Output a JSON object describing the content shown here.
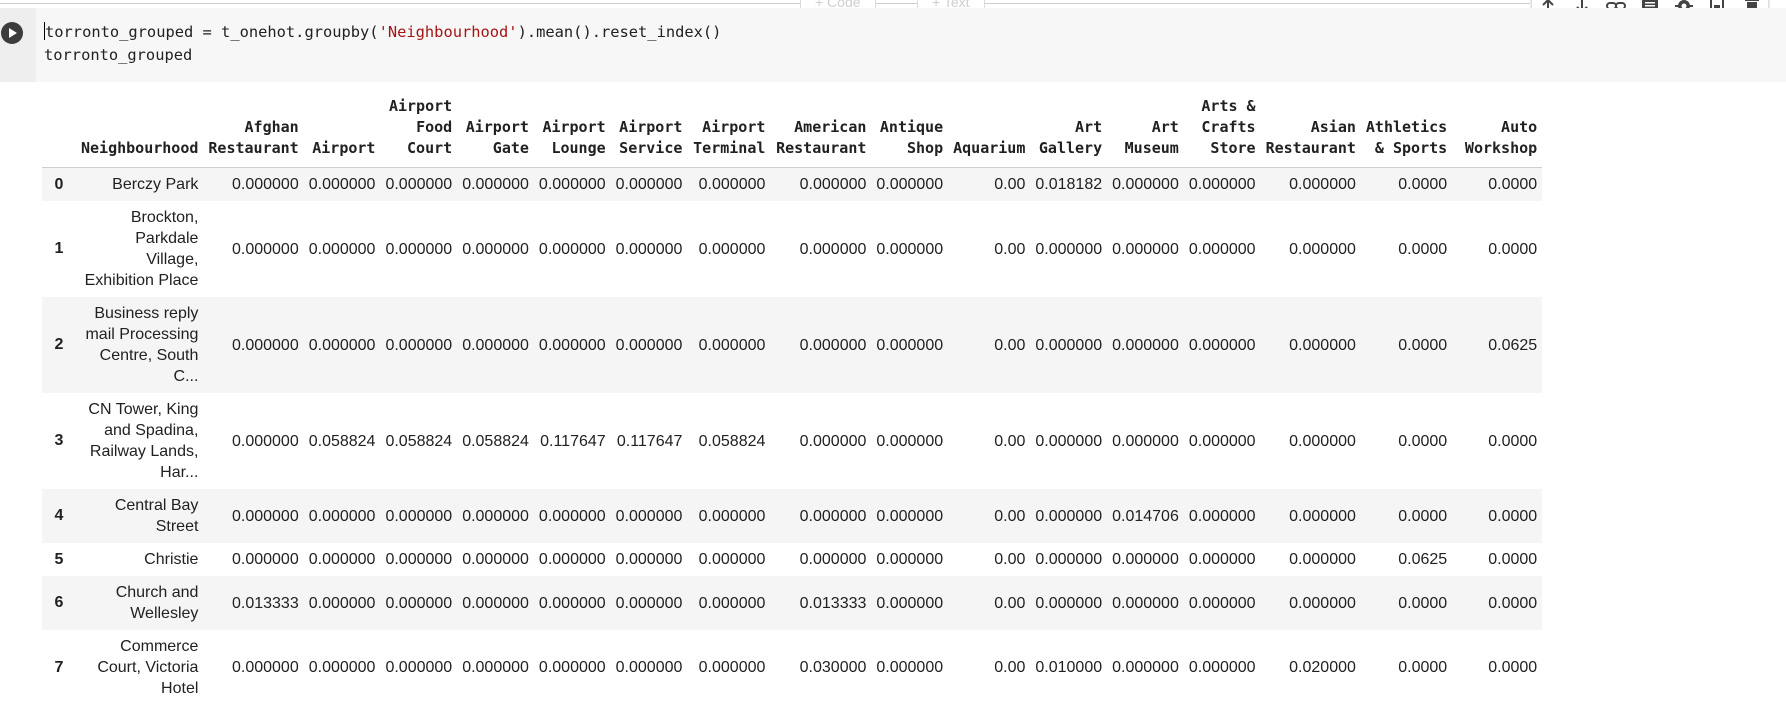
{
  "toolbar": {
    "add_code_label": "+ Code",
    "add_text_label": "+ Text",
    "icons": [
      "arrow-up-icon",
      "arrow-down-icon",
      "link-icon",
      "comment-icon",
      "gear-icon",
      "mirror-cell-icon",
      "delete-icon"
    ]
  },
  "cell": {
    "code_line1_a": "torronto_grouped = t_onehot.groupby(",
    "code_line1_str": "'Neighbourhood'",
    "code_line1_b": ").mean().reset_index()",
    "code_line2": "torronto_grouped"
  },
  "table": {
    "columns": [
      "Neighbourhood",
      "Afghan Restaurant",
      "Airport",
      "Airport Food Court",
      "Airport Gate",
      "Airport Lounge",
      "Airport Service",
      "Airport Terminal",
      "American Restaurant",
      "Antique Shop",
      "Aquarium",
      "Art Gallery",
      "Art Museum",
      "Arts & Crafts Store",
      "Asian Restaurant",
      "Athletics & Sports",
      "Auto Workshop"
    ],
    "rows": [
      {
        "index": "0",
        "cells": [
          "Berczy Park",
          "0.000000",
          "0.000000",
          "0.000000",
          "0.000000",
          "0.000000",
          "0.000000",
          "0.000000",
          "0.000000",
          "0.000000",
          "0.00",
          "0.018182",
          "0.000000",
          "0.000000",
          "0.000000",
          "0.0000",
          "0.0000"
        ]
      },
      {
        "index": "1",
        "cells": [
          "Brockton, Parkdale Village, Exhibition Place",
          "0.000000",
          "0.000000",
          "0.000000",
          "0.000000",
          "0.000000",
          "0.000000",
          "0.000000",
          "0.000000",
          "0.000000",
          "0.00",
          "0.000000",
          "0.000000",
          "0.000000",
          "0.000000",
          "0.0000",
          "0.0000"
        ]
      },
      {
        "index": "2",
        "cells": [
          "Business reply mail Processing Centre, South C...",
          "0.000000",
          "0.000000",
          "0.000000",
          "0.000000",
          "0.000000",
          "0.000000",
          "0.000000",
          "0.000000",
          "0.000000",
          "0.00",
          "0.000000",
          "0.000000",
          "0.000000",
          "0.000000",
          "0.0000",
          "0.0625"
        ]
      },
      {
        "index": "3",
        "cells": [
          "CN Tower, King and Spadina, Railway Lands, Har...",
          "0.000000",
          "0.058824",
          "0.058824",
          "0.058824",
          "0.117647",
          "0.117647",
          "0.058824",
          "0.000000",
          "0.000000",
          "0.00",
          "0.000000",
          "0.000000",
          "0.000000",
          "0.000000",
          "0.0000",
          "0.0000"
        ]
      },
      {
        "index": "4",
        "cells": [
          "Central Bay Street",
          "0.000000",
          "0.000000",
          "0.000000",
          "0.000000",
          "0.000000",
          "0.000000",
          "0.000000",
          "0.000000",
          "0.000000",
          "0.00",
          "0.000000",
          "0.014706",
          "0.000000",
          "0.000000",
          "0.0000",
          "0.0000"
        ]
      },
      {
        "index": "5",
        "cells": [
          "Christie",
          "0.000000",
          "0.000000",
          "0.000000",
          "0.000000",
          "0.000000",
          "0.000000",
          "0.000000",
          "0.000000",
          "0.000000",
          "0.00",
          "0.000000",
          "0.000000",
          "0.000000",
          "0.000000",
          "0.0625",
          "0.0000"
        ]
      },
      {
        "index": "6",
        "cells": [
          "Church and Wellesley",
          "0.013333",
          "0.000000",
          "0.000000",
          "0.000000",
          "0.000000",
          "0.000000",
          "0.000000",
          "0.013333",
          "0.000000",
          "0.00",
          "0.000000",
          "0.000000",
          "0.000000",
          "0.000000",
          "0.0000",
          "0.0000"
        ]
      },
      {
        "index": "7",
        "cells": [
          "Commerce Court, Victoria Hotel",
          "0.000000",
          "0.000000",
          "0.000000",
          "0.000000",
          "0.000000",
          "0.000000",
          "0.000000",
          "0.030000",
          "0.000000",
          "0.00",
          "0.010000",
          "0.000000",
          "0.000000",
          "0.020000",
          "0.0000",
          "0.0000"
        ]
      }
    ]
  }
}
